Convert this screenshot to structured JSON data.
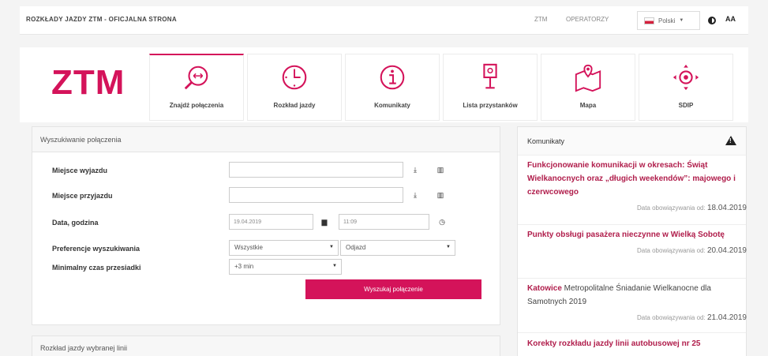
{
  "topbar": {
    "site_title": "ROZKŁADY JAZDY ZTM - OFICJALNA STRONA",
    "links": [
      "ZTM",
      "OPERATORZY"
    ],
    "language": "Polski",
    "font_size_label": "AA"
  },
  "logo": "ZTM",
  "tiles": [
    {
      "label": "Znajdź połączenia",
      "icon": "route-search-icon",
      "active": true
    },
    {
      "label": "Rozkład jazdy",
      "icon": "clock-icon",
      "active": false
    },
    {
      "label": "Komunikaty",
      "icon": "info-icon",
      "active": false
    },
    {
      "label": "Lista przystanków",
      "icon": "bus-stop-icon",
      "active": false
    },
    {
      "label": "Mapa",
      "icon": "map-icon",
      "active": false
    },
    {
      "label": "SDIP",
      "icon": "sdip-icon",
      "active": false
    }
  ],
  "search_panel": {
    "title": "Wyszukiwanie połączenia",
    "from_label": "Miejsce wyjazdu",
    "to_label": "Miejsce przyjazdu",
    "datetime_label": "Data, godzina",
    "date_value": "19.04.2019",
    "time_value": "11:09",
    "prefs_label": "Preferencje wyszukiwania",
    "pref_option": "Wszystkie",
    "pref_direction": "Odjazd",
    "transfer_label": "Minimalny czas przesiadki",
    "transfer_value": "+3 min",
    "submit_label": "Wyszukaj połączenie"
  },
  "lines_panel": {
    "title": "Rozkład jazdy wybranej linii"
  },
  "news": {
    "title": "Komunikaty",
    "date_prefix": "Data obowiązywania od:",
    "items": [
      {
        "title": "Funkcjonowanie komunikacji w okresach: Świąt Wielkanocnych oraz „długich weekendów”: majowego i czerwcowego",
        "date": "18.04.2019"
      },
      {
        "title": "Punkty obsługi pasażera nieczynne w Wielką Sobotę",
        "date": "20.04.2019"
      },
      {
        "title_bold": "Katowice",
        "title_plain": " Metropolitalne Śniadanie Wielkanocne dla Samotnych 2019",
        "date": "21.04.2019"
      },
      {
        "title": "Korekty rozkładu jazdy linii autobusowej nr 25"
      }
    ]
  },
  "colors": {
    "accent": "#d4135a",
    "news_title": "#b01d4b"
  }
}
